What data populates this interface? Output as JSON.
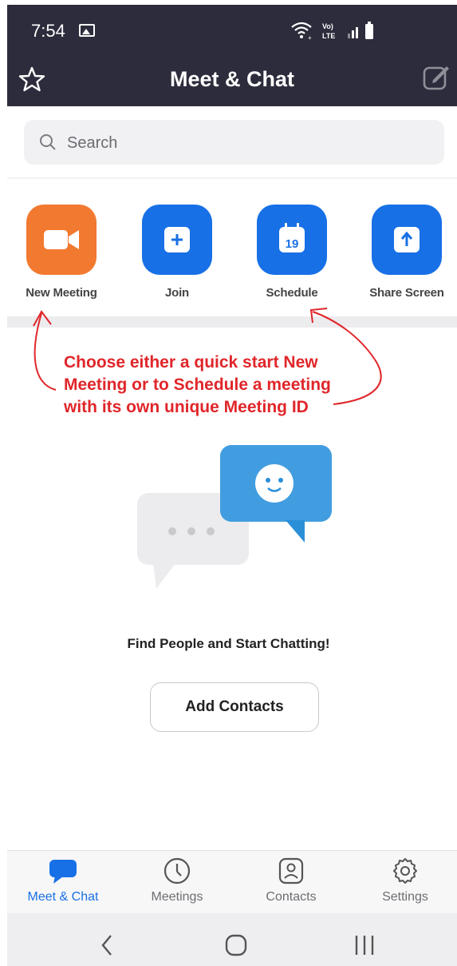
{
  "status_bar": {
    "time": "7:54",
    "lte_label_top": "Vo)",
    "lte_label_bottom": "LTE"
  },
  "header": {
    "title": "Meet & Chat"
  },
  "search": {
    "placeholder": "Search"
  },
  "actions": [
    {
      "label": "New Meeting",
      "icon": "video-camera-icon",
      "color": "#f27930"
    },
    {
      "label": "Join",
      "icon": "plus-icon",
      "color": "#1870e6"
    },
    {
      "label": "Schedule",
      "icon": "calendar-icon",
      "calendar_day": "19",
      "color": "#1870e6"
    },
    {
      "label": "Share Screen",
      "icon": "share-arrow-icon",
      "color": "#1870e6"
    }
  ],
  "annotation": {
    "line1": "Choose either a quick start New",
    "line2": "Meeting or to Schedule a meeting",
    "line3": "with its own unique Meeting ID",
    "color": "#e0262a"
  },
  "empty_state": {
    "title": "Find People and Start Chatting!",
    "button_label": "Add Contacts"
  },
  "bottom_nav": {
    "tabs": [
      {
        "label": "Meet & Chat",
        "icon": "chat-bubble-icon",
        "active": true
      },
      {
        "label": "Meetings",
        "icon": "clock-icon",
        "active": false
      },
      {
        "label": "Contacts",
        "icon": "contact-card-icon",
        "active": false
      },
      {
        "label": "Settings",
        "icon": "gear-icon",
        "active": false
      }
    ]
  },
  "colors": {
    "header_bg": "#2d2c3c",
    "accent": "#1870e6",
    "orange": "#f27930"
  }
}
